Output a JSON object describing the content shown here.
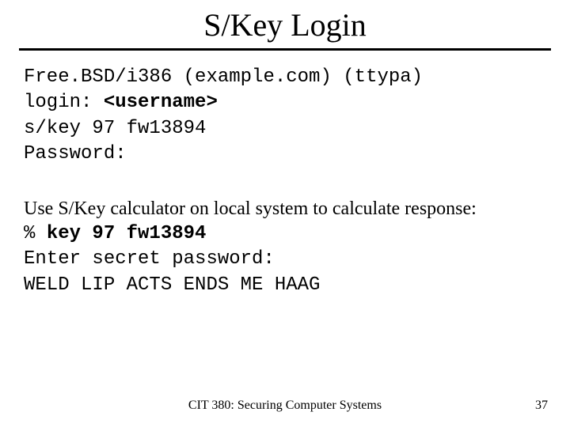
{
  "title": "S/Key Login",
  "block1": {
    "l1": "Free.BSD/i386 (example.com) (ttypa)",
    "l2a": "login: ",
    "l2b": "<username>",
    "l3": "s/key 97 fw13894",
    "l4": "Password:"
  },
  "block2": {
    "intro": "Use S/Key calculator on local system to calculate response:",
    "l1a": "% ",
    "l1b": "key 97 fw13894",
    "l2": "Enter secret password:",
    "l3": "WELD LIP ACTS ENDS ME HAAG"
  },
  "footer": {
    "course": "CIT 380: Securing Computer Systems",
    "page": "37"
  }
}
